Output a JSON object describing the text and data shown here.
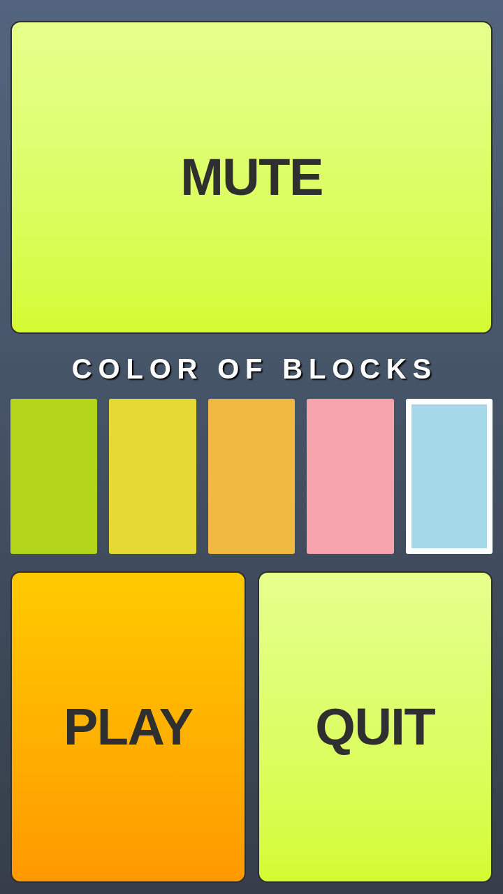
{
  "mute_button": {
    "label": "MUTE"
  },
  "heading": "COLOR OF BLOCKS",
  "swatches": [
    {
      "color": "#b3d61c",
      "selected": false
    },
    {
      "color": "#e5da35",
      "selected": false
    },
    {
      "color": "#f2b942",
      "selected": false
    },
    {
      "color": "#f7a3ae",
      "selected": false
    },
    {
      "color": "#a5d8e8",
      "selected": true
    }
  ],
  "play_button": {
    "label": "PLAY"
  },
  "quit_button": {
    "label": "QUIT"
  }
}
